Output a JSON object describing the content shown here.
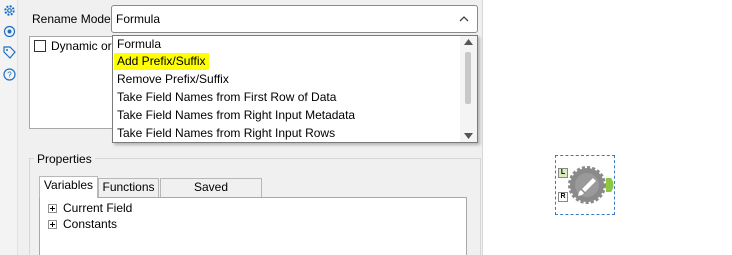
{
  "sidebar": {
    "icons": [
      "gear-icon",
      "tool-settings-icon",
      "tag-icon",
      "help-icon"
    ],
    "accent": "#1f6fc5"
  },
  "rename": {
    "label": "Rename Mode:",
    "value": "Formula"
  },
  "fields": {
    "option_label": "Dynamic or U"
  },
  "dropdown": {
    "highlight_color": "#ffff00",
    "options": [
      {
        "label": "Formula",
        "highlighted": false
      },
      {
        "label": "Add Prefix/Suffix",
        "highlighted": true
      },
      {
        "label": "Remove Prefix/Suffix",
        "highlighted": false
      },
      {
        "label": "Take Field Names from First Row of Data",
        "highlighted": false
      },
      {
        "label": "Take Field Names from Right Input Metadata",
        "highlighted": false
      },
      {
        "label": "Take Field Names from Right Input Rows",
        "highlighted": false
      }
    ]
  },
  "properties": {
    "label": "Properties",
    "tabs": [
      {
        "label": "Variables",
        "active": true
      },
      {
        "label": "Functions",
        "active": false
      },
      {
        "label": "Saved Expressions",
        "active": false
      }
    ],
    "tree": [
      {
        "label": "Current Field"
      },
      {
        "label": "Constants"
      }
    ]
  },
  "canvas_tool": {
    "name": "dynamic-rename-tool",
    "left_anchor": "L",
    "right_anchor": "R",
    "body_color": "#8a8a8a",
    "output_color": "#8dc63f"
  }
}
